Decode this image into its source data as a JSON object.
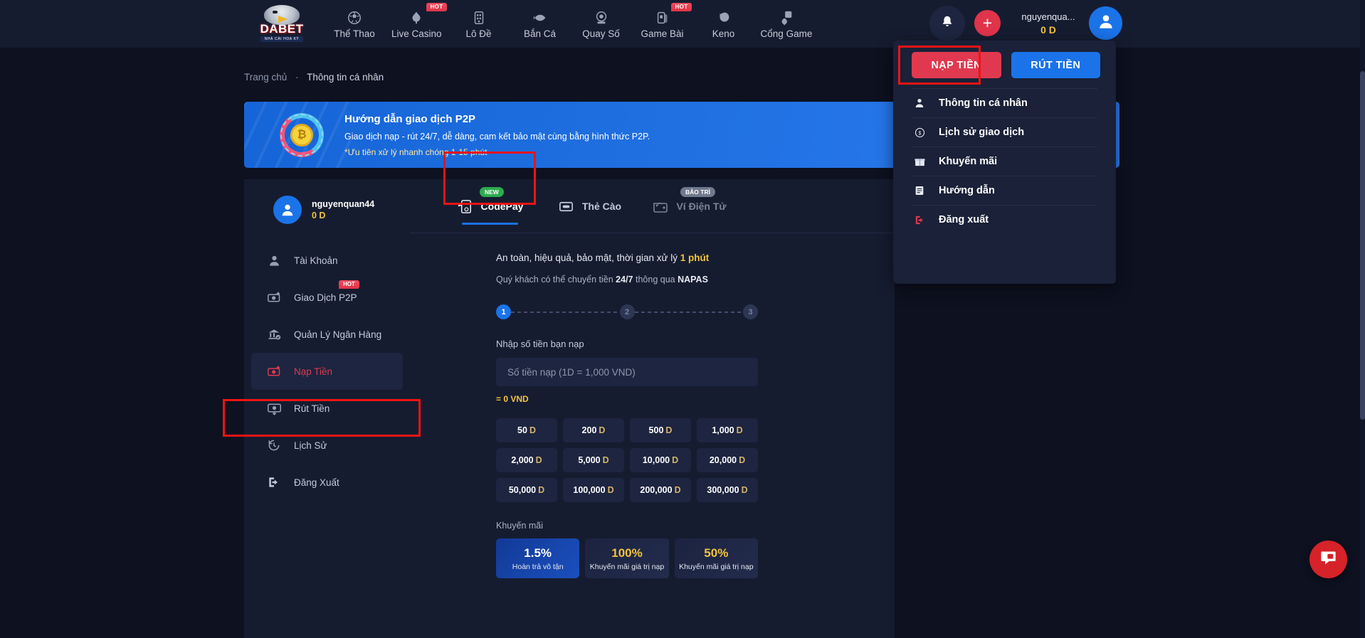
{
  "brand": {
    "name": "DABET",
    "tagline": "NHÀ CÁI HOA KỲ"
  },
  "header": {
    "nav": [
      {
        "label": "Thể Thao",
        "icon": "soccer-ball-icon",
        "badge": null
      },
      {
        "label": "Live Casino",
        "icon": "cards-icon",
        "badge": "HOT"
      },
      {
        "label": "Lô Đề",
        "icon": "lottery-icon",
        "badge": null
      },
      {
        "label": "Bắn Cá",
        "icon": "fish-icon",
        "badge": null
      },
      {
        "label": "Quay Số",
        "icon": "lottery-machine-icon",
        "badge": null
      },
      {
        "label": "Game Bài",
        "icon": "card-game-icon",
        "badge": "HOT"
      },
      {
        "label": "Keno",
        "icon": "keno-icon",
        "badge": null
      },
      {
        "label": "Cổng Game",
        "icon": "dice-icon",
        "badge": null
      }
    ],
    "bell_icon": "bell-icon",
    "add_icon": "plus-icon",
    "user_name": "nguyenqua...",
    "user_balance": "0 D",
    "avatar_icon": "user-avatar-icon"
  },
  "dropdown": {
    "deposit_label": "NẠP TIỀN",
    "withdraw_label": "RÚT TIỀN",
    "items": [
      {
        "label": "Thông tin cá nhân",
        "icon": "person-icon"
      },
      {
        "label": "Lịch sử giao dịch",
        "icon": "transaction-history-icon"
      },
      {
        "label": "Khuyến mãi",
        "icon": "gift-icon"
      },
      {
        "label": "Hướng dẫn",
        "icon": "document-icon"
      },
      {
        "label": "Đăng xuất",
        "icon": "logout-icon"
      }
    ]
  },
  "breadcrumb": {
    "home": "Trang chủ",
    "sep": "·",
    "current": "Thông tin cá nhân"
  },
  "banner": {
    "title": "Hướng dẫn giao dịch P2P",
    "line1": "Giao dịch nạp - rút 24/7, dễ dàng, cam kết bảo mật cùng bằng hình thức P2P.",
    "line2": "*Ưu tiên xử lý nhanh chóng 1-15 phút",
    "icon": "p2p-exchange-icon"
  },
  "sidebar": {
    "user_name": "nguyenquan44",
    "user_balance": "0 D",
    "items": [
      {
        "label": "Tài Khoản",
        "icon": "account-icon",
        "badge": null,
        "active": false
      },
      {
        "label": "Giao Dịch P2P",
        "icon": "p2p-money-icon",
        "badge": "HOT",
        "active": false
      },
      {
        "label": "Quản Lý Ngân Hàng",
        "icon": "bank-icon",
        "badge": null,
        "active": false
      },
      {
        "label": "Nạp Tiền",
        "icon": "deposit-icon",
        "badge": null,
        "active": true
      },
      {
        "label": "Rút Tiền",
        "icon": "withdraw-icon",
        "badge": null,
        "active": false
      },
      {
        "label": "Lịch Sử",
        "icon": "history-icon",
        "badge": null,
        "active": false
      },
      {
        "label": "Đăng Xuất",
        "icon": "logout-icon",
        "badge": null,
        "active": false
      }
    ]
  },
  "panel": {
    "tabs": [
      {
        "label": "CodePay",
        "icon": "codepay-icon",
        "badge": "NEW",
        "state": "selected"
      },
      {
        "label": "Thẻ Cào",
        "icon": "scratch-card-icon",
        "badge": null,
        "state": "normal"
      },
      {
        "label": "Ví Điện Tử",
        "icon": "e-wallet-icon",
        "badge": "BẢO TRÌ",
        "state": "disabled"
      }
    ],
    "safe_text_prefix": "An toàn, hiệu quả, bảo mật, thời gian xử lý ",
    "safe_text_highlight": "1 phút",
    "napas_prefix": "Quý khách có thể chuyển tiền ",
    "napas_bold1": "24/7",
    "napas_mid": " thông qua ",
    "napas_bold2": "NAPAS",
    "steps": [
      "1",
      "2",
      "3"
    ],
    "amount_label": "Nhập số tiền bạn nạp",
    "amount_placeholder": "Số tiền nạp (1D = 1,000 VND)",
    "amount_value": "",
    "vnd_text": "= 0 VND",
    "chips": [
      {
        "value": "50",
        "unit": "D"
      },
      {
        "value": "200",
        "unit": "D"
      },
      {
        "value": "500",
        "unit": "D"
      },
      {
        "value": "1,000",
        "unit": "D"
      },
      {
        "value": "2,000",
        "unit": "D"
      },
      {
        "value": "5,000",
        "unit": "D"
      },
      {
        "value": "10,000",
        "unit": "D"
      },
      {
        "value": "20,000",
        "unit": "D"
      },
      {
        "value": "50,000",
        "unit": "D"
      },
      {
        "value": "100,000",
        "unit": "D"
      },
      {
        "value": "200,000",
        "unit": "D"
      },
      {
        "value": "300,000",
        "unit": "D"
      }
    ],
    "promo_title": "Khuyến mãi",
    "promos": [
      {
        "value": "1.5%",
        "label": "Hoàn trả vô tận"
      },
      {
        "value": "100%",
        "label": "Khuyến mãi giá trị nạp"
      },
      {
        "value": "50%",
        "label": "Khuyến mãi giá trị nạp"
      }
    ]
  },
  "chat": {
    "icon": "chat-bubble-icon"
  },
  "colors": {
    "page_bg": "#0d1120",
    "panel_bg": "#161c30",
    "accent_red": "#e0394f",
    "accent_blue": "#1a73e8",
    "gold": "#f2c33c",
    "highlight_box": "#f01414"
  }
}
